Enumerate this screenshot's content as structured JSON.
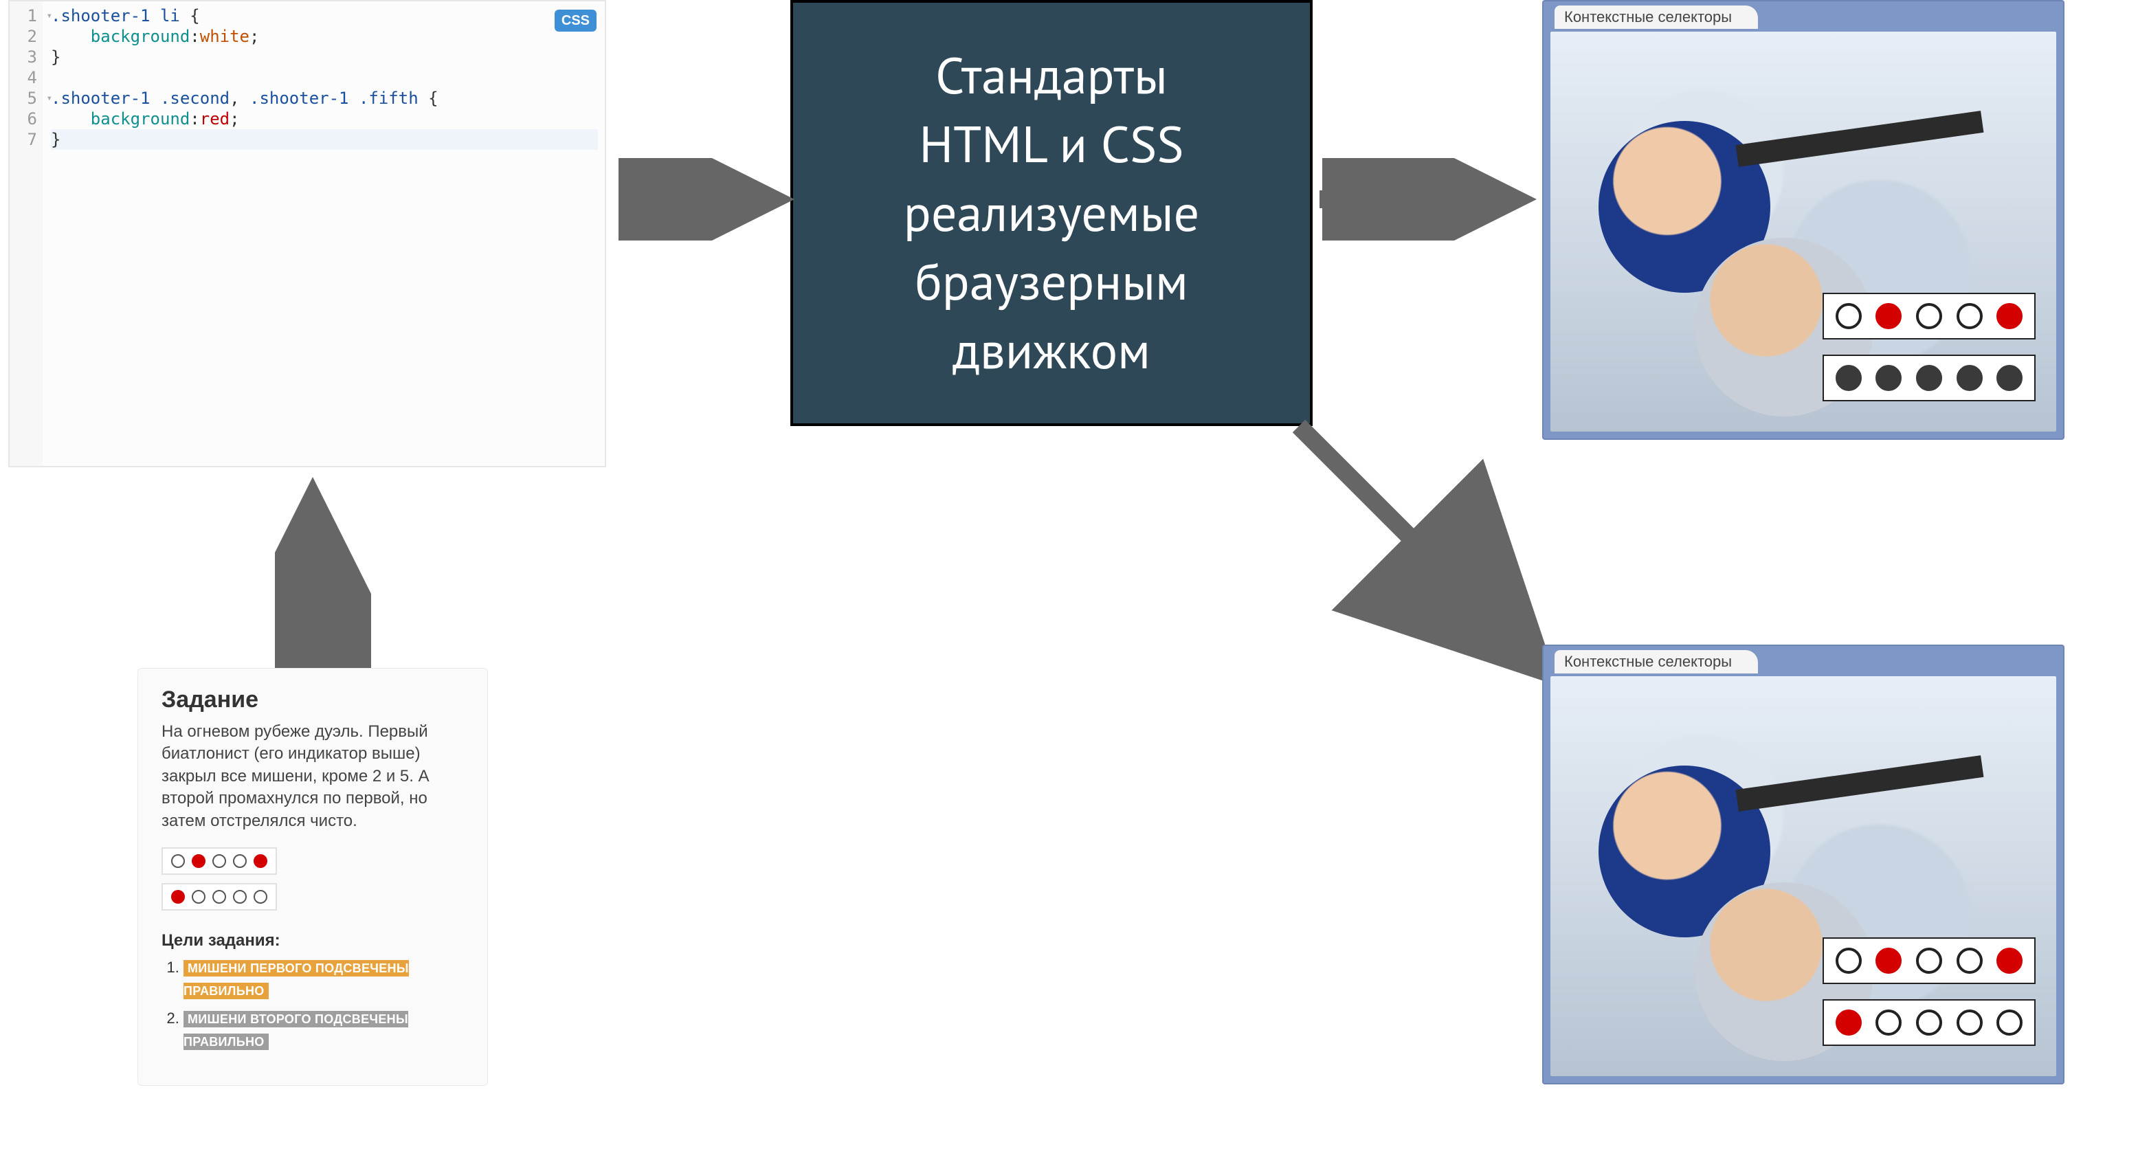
{
  "editor": {
    "badge": "CSS",
    "lines": [
      "1",
      "2",
      "3",
      "4",
      "5",
      "6",
      "7"
    ],
    "code": {
      "l1_sel": ".shooter-1 ",
      "l1_tag": "li",
      "l1_brace": " {",
      "l2_indent": "    ",
      "l2_prop": "background",
      "l2_colon": ":",
      "l2_val": "white",
      "l2_semi": ";",
      "l3": "}",
      "l4": "",
      "l5_a": ".shooter-1 .second",
      "l5_comma": ", ",
      "l5_b": ".shooter-1 .fifth",
      "l5_brace": " {",
      "l6_indent": "    ",
      "l6_prop": "background",
      "l6_colon": ":",
      "l6_val": "red",
      "l6_semi": ";",
      "l7": "}"
    }
  },
  "standards": "Стандарты\nHTML и CSS\nреализуемые\nбраузерным\nдвижком",
  "task": {
    "title": "Задание",
    "body": "На огневом рубеже дуэль. Первый биатлонист (его индикатор выше) закрыл все мишени, кроме 2 и 5. А второй промахнулся по первой, но затем отстрелялся чисто.",
    "row1": [
      "o",
      "r",
      "o",
      "o",
      "r"
    ],
    "row2": [
      "r",
      "o",
      "o",
      "o",
      "o"
    ],
    "goalsTitle": "Цели задания:",
    "goal1": "МИШЕНИ ПЕРВОГО ПОДСВЕЧЕНЫ ПРАВИЛЬНО",
    "goal2": "МИШЕНИ ВТОРОГО ПОДСВЕЧЕНЫ ПРАВИЛЬНО"
  },
  "preview": {
    "tab": "Контекстные селекторы",
    "top": {
      "row1": [
        "o",
        "r",
        "o",
        "o",
        "r"
      ],
      "row2": [
        "b",
        "b",
        "b",
        "b",
        "b"
      ]
    },
    "bottom": {
      "row1": [
        "o",
        "r",
        "o",
        "o",
        "r"
      ],
      "row2": [
        "r",
        "o",
        "o",
        "o",
        "o"
      ]
    }
  }
}
